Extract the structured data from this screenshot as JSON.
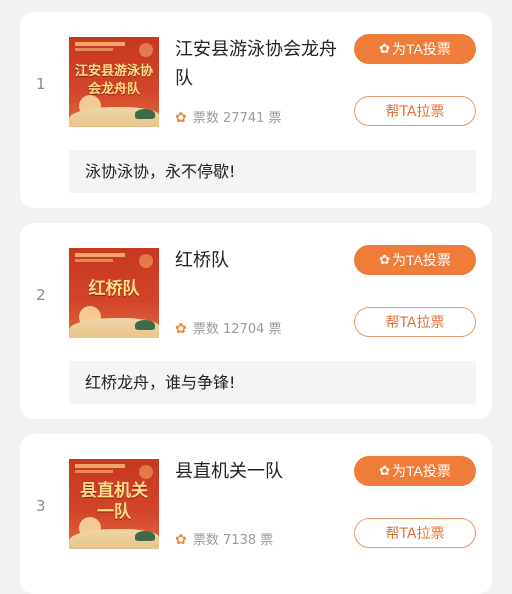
{
  "vote_count_prefix": "票数",
  "vote_count_suffix": "票",
  "teams": [
    {
      "rank": "1",
      "name": "江安县游泳协会龙舟队",
      "poster_title": "江安县游泳协会龙舟队",
      "votes": "27741",
      "slogan": "泳协泳协，永不停歇!",
      "vote_button": "为TA投票",
      "pull_button": "帮TA拉票"
    },
    {
      "rank": "2",
      "name": "红桥队",
      "poster_title": "红桥队",
      "votes": "12704",
      "slogan": "红桥龙舟，谁与争锋!",
      "vote_button": "为TA投票",
      "pull_button": "帮TA拉票"
    },
    {
      "rank": "3",
      "name": "县直机关一队",
      "poster_title": "县直机关一队",
      "votes": "7138",
      "slogan": "",
      "vote_button": "为TA投票",
      "pull_button": "帮TA拉票"
    }
  ],
  "colors": {
    "accent": "#f07c3a",
    "poster_red": "#c7381f",
    "poster_text": "#ffe08a"
  },
  "icons": {
    "vote_button_icon": "lotus-icon",
    "vote_count_icon": "lotus-icon"
  }
}
